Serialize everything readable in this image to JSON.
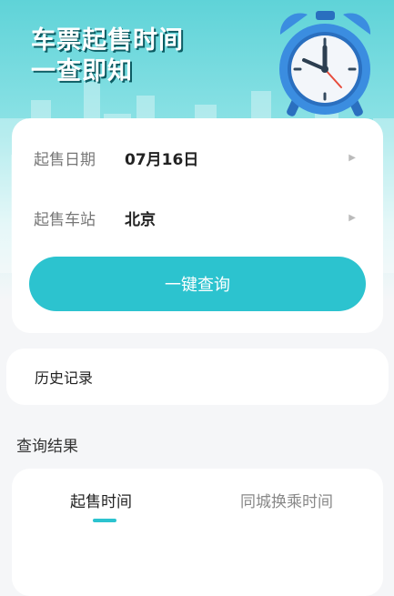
{
  "hero": {
    "title_line1": "车票起售时间",
    "title_line2": "一查即知"
  },
  "query": {
    "date_label": "起售日期",
    "date_value": "07月16日",
    "station_label": "起售车站",
    "station_value": "北京",
    "button_label": "一键查询"
  },
  "history": {
    "label": "历史记录"
  },
  "results": {
    "section_title": "查询结果",
    "tabs": [
      {
        "label": "起售时间",
        "active": true
      },
      {
        "label": "同城换乘时间",
        "active": false
      }
    ]
  },
  "colors": {
    "accent": "#2cc3cf",
    "hero_top": "#5fd3d8",
    "clock_blue": "#3b8de0"
  },
  "icons": {
    "hero_illustration": "alarm-clock-icon",
    "row_arrow": "chevron-right-icon"
  }
}
